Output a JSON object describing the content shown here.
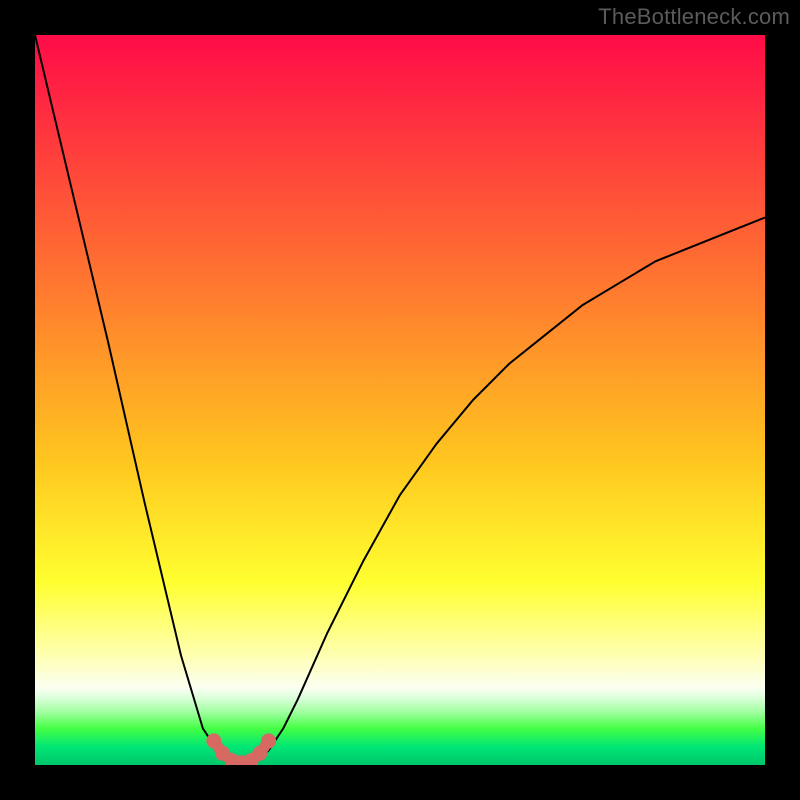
{
  "watermark": "TheBottleneck.com",
  "chart_data": {
    "type": "line",
    "title": "",
    "xlabel": "",
    "ylabel": "",
    "xlim": [
      0,
      100
    ],
    "ylim": [
      0,
      100
    ],
    "grid": false,
    "series": [
      {
        "name": "bottleneck-curve",
        "x": [
          0,
          5,
          10,
          15,
          20,
          23,
          25,
          27,
          28,
          29,
          30,
          32,
          34,
          36,
          40,
          45,
          50,
          55,
          60,
          65,
          70,
          75,
          80,
          85,
          90,
          95,
          100
        ],
        "y": [
          100,
          79,
          58,
          36,
          15,
          5,
          2,
          0.5,
          0,
          0,
          0.5,
          2,
          5,
          9,
          18,
          28,
          37,
          44,
          50,
          55,
          59,
          63,
          66,
          69,
          71,
          73,
          75
        ]
      }
    ],
    "markers": {
      "name": "highlight-dots",
      "x": [
        24.5,
        25.7,
        27.0,
        28.3,
        29.6,
        30.8,
        32.0
      ],
      "y": [
        3.3,
        1.6,
        0.6,
        0.3,
        0.6,
        1.6,
        3.3
      ]
    },
    "gradient_stops": [
      {
        "pos": 0.0,
        "color": "#ff0b48"
      },
      {
        "pos": 0.35,
        "color": "#ff7a2f"
      },
      {
        "pos": 0.58,
        "color": "#ffc51f"
      },
      {
        "pos": 0.75,
        "color": "#ffff30"
      },
      {
        "pos": 0.85,
        "color": "#ffffb2"
      },
      {
        "pos": 0.895,
        "color": "#fafff2"
      },
      {
        "pos": 0.91,
        "color": "#d6ffd6"
      },
      {
        "pos": 0.928,
        "color": "#9fff9f"
      },
      {
        "pos": 0.95,
        "color": "#45ff45"
      },
      {
        "pos": 0.975,
        "color": "#00e676"
      },
      {
        "pos": 1.0,
        "color": "#00c56a"
      }
    ],
    "colors": {
      "curve": "#000000",
      "marker": "#d66a63",
      "background_frame": "#000000"
    }
  }
}
